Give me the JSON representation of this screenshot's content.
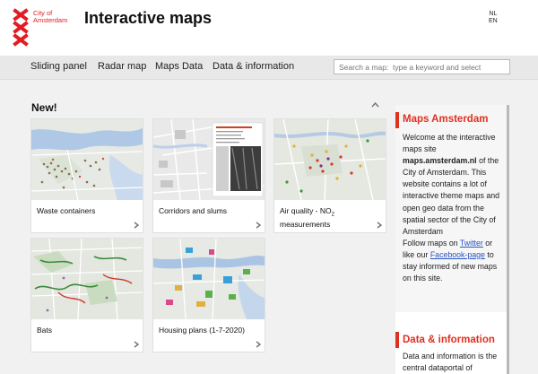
{
  "header": {
    "logo_text": "City of\nAmsterdam",
    "logo_line1": "City of",
    "logo_line2": "Amsterdam",
    "title": "Interactive maps",
    "languages": [
      "NL",
      "EN"
    ]
  },
  "nav": {
    "items": [
      "Sliding panel",
      "Radar map",
      "Maps Data",
      "Data & information"
    ],
    "search_placeholder": "Search a map:  type a keyword and select"
  },
  "main": {
    "section_title": "New!",
    "cards": [
      {
        "label": "Waste containers"
      },
      {
        "label": "Corridors and slums"
      },
      {
        "label_pre": "Air quality - NO",
        "label_sub": "2",
        "label_line2": "measurements"
      },
      {
        "label": "Bats"
      },
      {
        "label": "Housing plans (1-7-2020)"
      }
    ]
  },
  "sidebar": {
    "box_title": "Maps Amsterdam",
    "intro_1": "Welcome at the interactive maps site",
    "site_name": "maps.amsterdam.nl",
    "intro_2": "of the City of Amsterdam. This website contains a lot of interactive theme maps and open geo data from the spatial sector of the City of Amsterdam",
    "follow_pre": "Follow maps on",
    "twitter": "Twitter",
    "follow_mid": "or like our",
    "facebook": "Facebook-page",
    "follow_post": "to stay informed of new maps on this site.",
    "section2_title": "Data & information",
    "section2_text": "Data and information is the central dataportal of"
  },
  "colors": {
    "brand_red": "#e31c23",
    "accent_red": "#e03020",
    "link_blue": "#2a55c0",
    "nav_bg": "#e8e8e8"
  }
}
